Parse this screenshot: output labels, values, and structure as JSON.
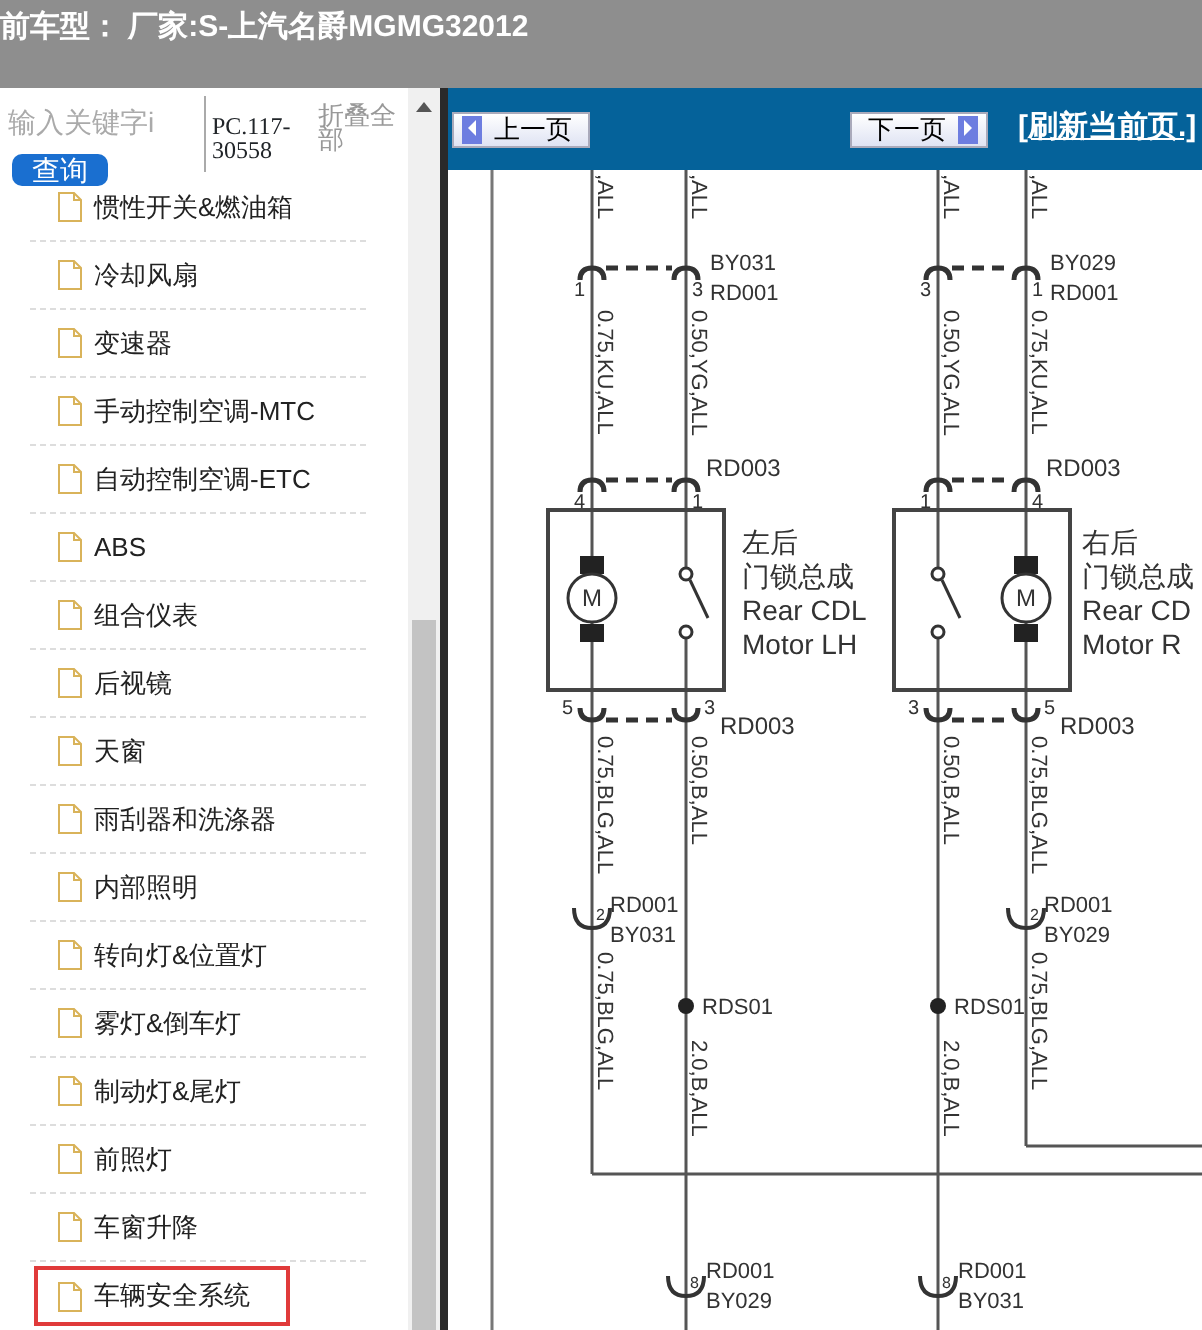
{
  "header": {
    "title": "前车型：  厂家:S-上汽名爵MGMG32012"
  },
  "sidebar": {
    "search": {
      "placeholder": "输入关键字i"
    },
    "search_button": "查询",
    "code": "PC.117-30558",
    "collapse_all": "折叠全部",
    "items": [
      {
        "label": "惯性开关&燃油箱",
        "selected": false
      },
      {
        "label": "冷却风扇",
        "selected": false
      },
      {
        "label": "变速器",
        "selected": false
      },
      {
        "label": "手动控制空调-MTC",
        "selected": false
      },
      {
        "label": "自动控制空调-ETC",
        "selected": false
      },
      {
        "label": "ABS",
        "selected": false
      },
      {
        "label": "组合仪表",
        "selected": false
      },
      {
        "label": "后视镜",
        "selected": false
      },
      {
        "label": "天窗",
        "selected": false
      },
      {
        "label": "雨刮器和洗涤器",
        "selected": false
      },
      {
        "label": "内部照明",
        "selected": false
      },
      {
        "label": "转向灯&位置灯",
        "selected": false
      },
      {
        "label": "雾灯&倒车灯",
        "selected": false
      },
      {
        "label": "制动灯&尾灯",
        "selected": false
      },
      {
        "label": "前照灯",
        "selected": false
      },
      {
        "label": "车窗升降",
        "selected": false
      },
      {
        "label": "车辆安全系统",
        "selected": true
      }
    ]
  },
  "toolbar": {
    "prev_button": "上一页",
    "next_button": "下一页",
    "refresh_link": "[刷新当前页.]"
  },
  "diagram": {
    "components": [
      {
        "top_wire_labels": [
          ",ALL",
          ",ALL"
        ],
        "top_connector": {
          "pins": [
            "1",
            "3"
          ],
          "codes": [
            "BY031",
            "RD001"
          ]
        },
        "upper_wire_labels": [
          "0.75,KU,ALL",
          "0.50,YG,ALL"
        ],
        "mid_connector": {
          "pins": [
            "4",
            "1"
          ],
          "code": "RD003"
        },
        "motor_label": "M",
        "name_lines": [
          "左后",
          "门锁总成",
          "Rear CDL",
          "Motor LH"
        ],
        "bottom_connector": {
          "pins": [
            "5",
            "3"
          ],
          "code": "RD003"
        },
        "lower_wire_labels": [
          "0.75,BLG,ALL",
          "0.50,B,ALL"
        ],
        "splice_connector": {
          "pin": "2",
          "codes": [
            "RD001",
            "BY031"
          ]
        },
        "ground_wire_label": "0.75,BLG,ALL",
        "splice": "RDS01",
        "trunk_label": "2.0,B,ALL",
        "end_connector": {
          "pin": "8",
          "codes": [
            "RD001",
            "BY029"
          ]
        }
      },
      {
        "top_wire_labels": [
          ",ALL",
          ",ALL"
        ],
        "top_connector": {
          "pins": [
            "3",
            "1"
          ],
          "codes": [
            "BY029",
            "RD001"
          ]
        },
        "upper_wire_labels": [
          "0.50,YG,ALL",
          "0.75,KU,ALL"
        ],
        "mid_connector": {
          "pins": [
            "1",
            "4"
          ],
          "code": "RD003"
        },
        "motor_label": "M",
        "name_lines": [
          "右后",
          "门锁总成",
          "Rear CD",
          "Motor R"
        ],
        "bottom_connector": {
          "pins": [
            "3",
            "5"
          ],
          "code": "RD003"
        },
        "lower_wire_labels": [
          "0.50,B,ALL",
          "0.75,BLG,ALL"
        ],
        "splice_connector": {
          "pin": "2",
          "codes": [
            "RD001",
            "BY029"
          ]
        },
        "ground_wire_label": "0.75,BLG,ALL",
        "splice": "RDS01",
        "trunk_label": "2.0,B,ALL",
        "end_connector": {
          "pin": "8",
          "codes": [
            "RD001",
            "BY031"
          ]
        }
      }
    ]
  }
}
